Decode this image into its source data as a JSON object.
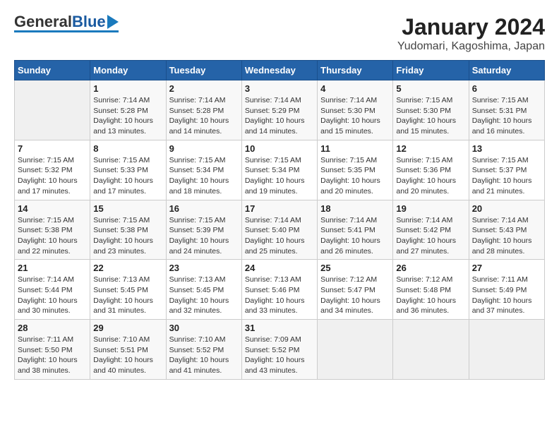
{
  "header": {
    "logo_general": "General",
    "logo_blue": "Blue",
    "title": "January 2024",
    "subtitle": "Yudomari, Kagoshima, Japan"
  },
  "weekdays": [
    "Sunday",
    "Monday",
    "Tuesday",
    "Wednesday",
    "Thursday",
    "Friday",
    "Saturday"
  ],
  "weeks": [
    [
      {
        "day": "",
        "info": ""
      },
      {
        "day": "1",
        "info": "Sunrise: 7:14 AM\nSunset: 5:28 PM\nDaylight: 10 hours\nand 13 minutes."
      },
      {
        "day": "2",
        "info": "Sunrise: 7:14 AM\nSunset: 5:28 PM\nDaylight: 10 hours\nand 14 minutes."
      },
      {
        "day": "3",
        "info": "Sunrise: 7:14 AM\nSunset: 5:29 PM\nDaylight: 10 hours\nand 14 minutes."
      },
      {
        "day": "4",
        "info": "Sunrise: 7:14 AM\nSunset: 5:30 PM\nDaylight: 10 hours\nand 15 minutes."
      },
      {
        "day": "5",
        "info": "Sunrise: 7:15 AM\nSunset: 5:30 PM\nDaylight: 10 hours\nand 15 minutes."
      },
      {
        "day": "6",
        "info": "Sunrise: 7:15 AM\nSunset: 5:31 PM\nDaylight: 10 hours\nand 16 minutes."
      }
    ],
    [
      {
        "day": "7",
        "info": "Sunrise: 7:15 AM\nSunset: 5:32 PM\nDaylight: 10 hours\nand 17 minutes."
      },
      {
        "day": "8",
        "info": "Sunrise: 7:15 AM\nSunset: 5:33 PM\nDaylight: 10 hours\nand 17 minutes."
      },
      {
        "day": "9",
        "info": "Sunrise: 7:15 AM\nSunset: 5:34 PM\nDaylight: 10 hours\nand 18 minutes."
      },
      {
        "day": "10",
        "info": "Sunrise: 7:15 AM\nSunset: 5:34 PM\nDaylight: 10 hours\nand 19 minutes."
      },
      {
        "day": "11",
        "info": "Sunrise: 7:15 AM\nSunset: 5:35 PM\nDaylight: 10 hours\nand 20 minutes."
      },
      {
        "day": "12",
        "info": "Sunrise: 7:15 AM\nSunset: 5:36 PM\nDaylight: 10 hours\nand 20 minutes."
      },
      {
        "day": "13",
        "info": "Sunrise: 7:15 AM\nSunset: 5:37 PM\nDaylight: 10 hours\nand 21 minutes."
      }
    ],
    [
      {
        "day": "14",
        "info": "Sunrise: 7:15 AM\nSunset: 5:38 PM\nDaylight: 10 hours\nand 22 minutes."
      },
      {
        "day": "15",
        "info": "Sunrise: 7:15 AM\nSunset: 5:38 PM\nDaylight: 10 hours\nand 23 minutes."
      },
      {
        "day": "16",
        "info": "Sunrise: 7:15 AM\nSunset: 5:39 PM\nDaylight: 10 hours\nand 24 minutes."
      },
      {
        "day": "17",
        "info": "Sunrise: 7:14 AM\nSunset: 5:40 PM\nDaylight: 10 hours\nand 25 minutes."
      },
      {
        "day": "18",
        "info": "Sunrise: 7:14 AM\nSunset: 5:41 PM\nDaylight: 10 hours\nand 26 minutes."
      },
      {
        "day": "19",
        "info": "Sunrise: 7:14 AM\nSunset: 5:42 PM\nDaylight: 10 hours\nand 27 minutes."
      },
      {
        "day": "20",
        "info": "Sunrise: 7:14 AM\nSunset: 5:43 PM\nDaylight: 10 hours\nand 28 minutes."
      }
    ],
    [
      {
        "day": "21",
        "info": "Sunrise: 7:14 AM\nSunset: 5:44 PM\nDaylight: 10 hours\nand 30 minutes."
      },
      {
        "day": "22",
        "info": "Sunrise: 7:13 AM\nSunset: 5:45 PM\nDaylight: 10 hours\nand 31 minutes."
      },
      {
        "day": "23",
        "info": "Sunrise: 7:13 AM\nSunset: 5:45 PM\nDaylight: 10 hours\nand 32 minutes."
      },
      {
        "day": "24",
        "info": "Sunrise: 7:13 AM\nSunset: 5:46 PM\nDaylight: 10 hours\nand 33 minutes."
      },
      {
        "day": "25",
        "info": "Sunrise: 7:12 AM\nSunset: 5:47 PM\nDaylight: 10 hours\nand 34 minutes."
      },
      {
        "day": "26",
        "info": "Sunrise: 7:12 AM\nSunset: 5:48 PM\nDaylight: 10 hours\nand 36 minutes."
      },
      {
        "day": "27",
        "info": "Sunrise: 7:11 AM\nSunset: 5:49 PM\nDaylight: 10 hours\nand 37 minutes."
      }
    ],
    [
      {
        "day": "28",
        "info": "Sunrise: 7:11 AM\nSunset: 5:50 PM\nDaylight: 10 hours\nand 38 minutes."
      },
      {
        "day": "29",
        "info": "Sunrise: 7:10 AM\nSunset: 5:51 PM\nDaylight: 10 hours\nand 40 minutes."
      },
      {
        "day": "30",
        "info": "Sunrise: 7:10 AM\nSunset: 5:52 PM\nDaylight: 10 hours\nand 41 minutes."
      },
      {
        "day": "31",
        "info": "Sunrise: 7:09 AM\nSunset: 5:52 PM\nDaylight: 10 hours\nand 43 minutes."
      },
      {
        "day": "",
        "info": ""
      },
      {
        "day": "",
        "info": ""
      },
      {
        "day": "",
        "info": ""
      }
    ]
  ]
}
